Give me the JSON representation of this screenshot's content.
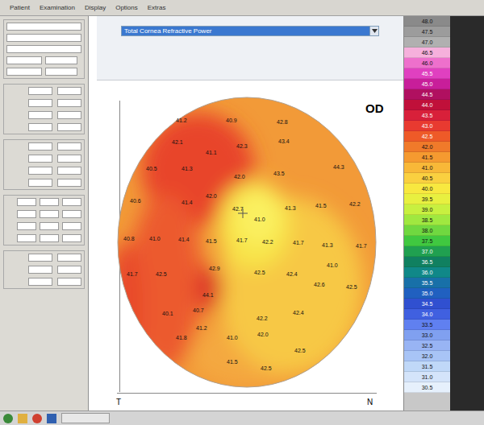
{
  "menu": [
    "Patient",
    "Examination",
    "Display",
    "Options",
    "Extras"
  ],
  "view_select": {
    "value": "Total Cornea Refractive Power"
  },
  "map": {
    "eye": "OD",
    "axis_left": "T",
    "axis_right": "N",
    "points": [
      {
        "value": "41.2"
      },
      {
        "value": "40.9"
      },
      {
        "value": "42.8"
      },
      {
        "value": "42.1"
      },
      {
        "value": "41.1"
      },
      {
        "value": "42.3"
      },
      {
        "value": "43.4"
      },
      {
        "value": "40.5"
      },
      {
        "value": "41.3"
      },
      {
        "value": "42.0"
      },
      {
        "value": "43.5"
      },
      {
        "value": "44.3"
      },
      {
        "value": "40.6"
      },
      {
        "value": "41.4"
      },
      {
        "value": "42.0"
      },
      {
        "value": "42.7"
      },
      {
        "value": "41.0"
      },
      {
        "value": "41.3"
      },
      {
        "value": "41.5"
      },
      {
        "value": "42.2"
      },
      {
        "value": "40.8"
      },
      {
        "value": "41.0"
      },
      {
        "value": "41.4"
      },
      {
        "value": "41.5"
      },
      {
        "value": "41.7"
      },
      {
        "value": "42.2"
      },
      {
        "value": "41.7"
      },
      {
        "value": "41.3"
      },
      {
        "value": "41.7"
      },
      {
        "value": "41.7"
      },
      {
        "value": "42.5"
      },
      {
        "value": "42.9"
      },
      {
        "value": "42.5"
      },
      {
        "value": "42.4"
      },
      {
        "value": "41.0"
      },
      {
        "value": "44.1"
      },
      {
        "value": "42.6"
      },
      {
        "value": "42.5"
      },
      {
        "value": "40.1"
      },
      {
        "value": "40.7"
      },
      {
        "value": "42.2"
      },
      {
        "value": "42.4"
      },
      {
        "value": "41.2"
      },
      {
        "value": "41.0"
      },
      {
        "value": "42.0"
      },
      {
        "value": "42.5"
      },
      {
        "value": "41.5"
      },
      {
        "value": "42.5"
      },
      {
        "value": "41.8"
      }
    ]
  },
  "scale": [
    {
      "value": "48.0",
      "color": "#8a8a8a"
    },
    {
      "value": "47.5",
      "color": "#9c9c9c"
    },
    {
      "value": "47.0",
      "color": "#b0b0b0"
    },
    {
      "value": "46.5",
      "color": "#f6b0dc"
    },
    {
      "value": "46.0",
      "color": "#ee70cc"
    },
    {
      "value": "45.5",
      "color": "#e040c0"
    },
    {
      "value": "45.0",
      "color": "#c81e9a"
    },
    {
      "value": "44.5",
      "color": "#b01060"
    },
    {
      "value": "44.0",
      "color": "#c0103a"
    },
    {
      "value": "43.5",
      "color": "#d8203a"
    },
    {
      "value": "43.0",
      "color": "#e83a30"
    },
    {
      "value": "42.5",
      "color": "#ee5a28"
    },
    {
      "value": "42.0",
      "color": "#f07a2a"
    },
    {
      "value": "41.5",
      "color": "#f59a30"
    },
    {
      "value": "41.0",
      "color": "#f8b838"
    },
    {
      "value": "40.5",
      "color": "#fad040"
    },
    {
      "value": "40.0",
      "color": "#f8e840"
    },
    {
      "value": "39.5",
      "color": "#e8f040"
    },
    {
      "value": "39.0",
      "color": "#c8f040"
    },
    {
      "value": "38.5",
      "color": "#a0e840"
    },
    {
      "value": "38.0",
      "color": "#70d840"
    },
    {
      "value": "37.5",
      "color": "#40c840"
    },
    {
      "value": "37.0",
      "color": "#20a050"
    },
    {
      "value": "36.5",
      "color": "#108060"
    },
    {
      "value": "36.0",
      "color": "#108888"
    },
    {
      "value": "35.5",
      "color": "#1870a8"
    },
    {
      "value": "35.0",
      "color": "#2060c0"
    },
    {
      "value": "34.5",
      "color": "#3050d0"
    },
    {
      "value": "34.0",
      "color": "#4060e0"
    },
    {
      "value": "33.5",
      "color": "#6080f0"
    },
    {
      "value": "33.0",
      "color": "#80a0f0"
    },
    {
      "value": "32.5",
      "color": "#98b4f4"
    },
    {
      "value": "32.0",
      "color": "#a8c4f6"
    },
    {
      "value": "31.5",
      "color": "#c0d8f8"
    },
    {
      "value": "31.0",
      "color": "#d4e4fa"
    },
    {
      "value": "30.5",
      "color": "#e6f0fc"
    }
  ]
}
